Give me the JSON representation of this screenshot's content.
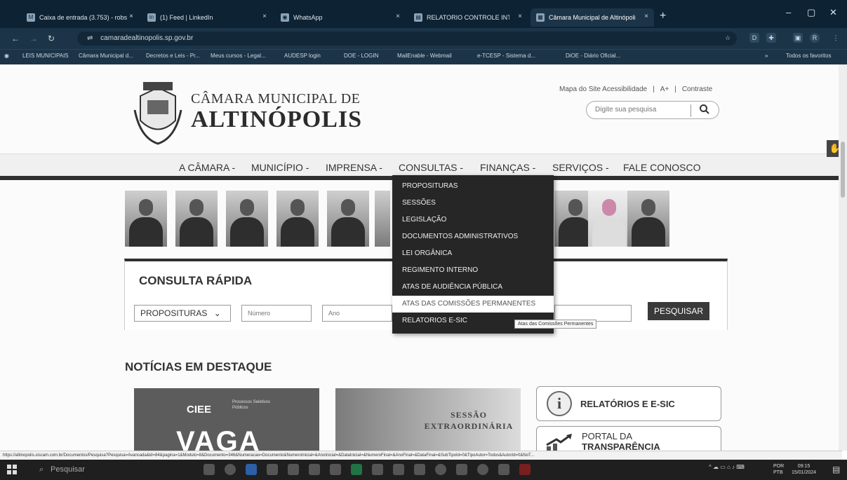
{
  "browser": {
    "tabs": [
      {
        "label": "Caixa de entrada (3.753) - robs",
        "icon": "gmail-icon",
        "active": false
      },
      {
        "label": "(1) Feed | LinkedIn",
        "icon": "linkedin-icon",
        "active": false
      },
      {
        "label": "WhatsApp",
        "icon": "whatsapp-icon",
        "active": false
      },
      {
        "label": "RELATORIO CONTROLE INTERN",
        "icon": "doc-icon",
        "active": false
      },
      {
        "label": "Câmara Municipal de Altinópoli",
        "icon": "camara-icon",
        "active": true
      }
    ],
    "url": "camaradealtinopolis.sp.gov.br",
    "bookmarks": [
      "LEIS MUNICIPAIS",
      "Câmara Municipal d...",
      "Decretos e Leis - Pr...",
      "Meus cursos - Legal...",
      "AUDESP login",
      "DOE - LOGIN",
      "MailEnable - Webmail",
      "e-TCESP - Sistema d...",
      "DiOE - Diário Oficial..."
    ],
    "all_bookmarks": "Todos os favoritos"
  },
  "site": {
    "title_line1": "CÂMARA MUNICIPAL DE",
    "title_line2": "ALTINÓPOLIS",
    "accessibility": [
      "Mapa do Site Acessibilidade",
      "|",
      "A+",
      "|",
      "Contraste"
    ],
    "search_placeholder": "Digite sua pesquisa",
    "nav": [
      "A CÂMARA -",
      "MUNICÍPIO -",
      "IMPRENSA -",
      "CONSULTAS -",
      "FINANÇAS -",
      "SERVIÇOS -",
      "FALE CONOSCO"
    ],
    "consultas_menu": [
      "PROPOSITURAS",
      "SESSÕES",
      "LEGISLAÇÃO",
      "DOCUMENTOS ADMINISTRATIVOS",
      "LEI ORGÂNICA",
      "REGIMENTO INTERNO",
      "ATAS DE AUDIÊNCIA PÚBLICA",
      "ATAS DAS COMISSÕES PERMANENTES",
      "RELATORIOS E-SIC"
    ],
    "tooltip": "Atas das Comissões Permanentes",
    "consulta_rapida": {
      "heading": "CONSULTA RÁPIDA",
      "type_select": "PROPOSITURAS",
      "numero_placeholder": "Número",
      "ano_placeholder": "Ano",
      "button": "PESQUISAR"
    },
    "noticias_heading": "NOTÍCIAS EM DESTAQUE",
    "card1": {
      "brand": "CIEE",
      "sub": "Processos Seletivos Públicos",
      "headline": "VAGA"
    },
    "card2": {
      "line1": "SESSÃO",
      "line2": "EXTRAORDINÁRIA"
    },
    "relatorios_box": {
      "icon_letter": "i",
      "label": "RELATÓRIOS E E-SIC"
    },
    "portal_box": {
      "line1": "PORTAL DA",
      "line2": "TRANSPARÊNCIA"
    }
  },
  "status_url": "https://altinopolis.siscam.com.br/Documentos/Pesquisa?Pesquisa=Avancada&id=84&pagina=1&Modulo=8&Documento=346&Numeracao=Documento&NumeroInicial=&AnoInicial=&DataInicial=&NumeroFinal=&AnoFinal=&DataFinal=&SubTipoId=0&TipoAutor=Todos&AutorId=0&NoT...",
  "taskbar": {
    "search": "Pesquisar",
    "lang1": "POR",
    "lang2": "PTB",
    "time": "09:15",
    "date": "15/01/2024"
  }
}
